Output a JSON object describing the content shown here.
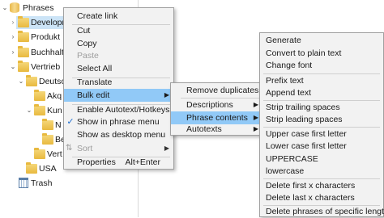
{
  "tree": {
    "items": [
      {
        "label": "Phrases"
      },
      {
        "label": "Developm"
      },
      {
        "label": "Produkt"
      },
      {
        "label": "Buchhaltu"
      },
      {
        "label": "Vertrieb"
      },
      {
        "label": "Deutsc"
      },
      {
        "label": "Akq"
      },
      {
        "label": "Kun"
      },
      {
        "label": "N"
      },
      {
        "label": "Be"
      },
      {
        "label": "Vert"
      },
      {
        "label": "USA"
      },
      {
        "label": "Trash"
      }
    ]
  },
  "context_menu": {
    "items": [
      {
        "label": "Create link"
      },
      {
        "label": "Cut"
      },
      {
        "label": "Copy"
      },
      {
        "label": "Paste"
      },
      {
        "label": "Select All"
      },
      {
        "label": "Translate"
      },
      {
        "label": "Bulk edit"
      },
      {
        "label": "Enable Autotext/Hotkeys"
      },
      {
        "label": "Show in phrase menu"
      },
      {
        "label": "Show as desktop menu"
      },
      {
        "label": "Sort"
      },
      {
        "label": "Properties",
        "shortcut": "Alt+Enter"
      }
    ]
  },
  "bulk_edit_menu": {
    "items": [
      {
        "label": "Remove duplicates"
      },
      {
        "label": "Descriptions"
      },
      {
        "label": "Phrase contents"
      },
      {
        "label": "Autotexts"
      }
    ]
  },
  "phrase_contents_menu": {
    "items": [
      {
        "label": "Generate"
      },
      {
        "label": "Convert to plain text"
      },
      {
        "label": "Change font"
      },
      {
        "label": "Prefix text"
      },
      {
        "label": "Append text"
      },
      {
        "label": "Strip trailing spaces"
      },
      {
        "label": "Strip leading spaces"
      },
      {
        "label": "Upper case first letter"
      },
      {
        "label": "Lower case first letter"
      },
      {
        "label": "UPPERCASE"
      },
      {
        "label": "lowercase"
      },
      {
        "label": "Delete first x characters"
      },
      {
        "label": "Delete last x characters"
      },
      {
        "label": "Delete phrases of specific length"
      }
    ]
  },
  "colors": {
    "highlight": "#91c9f7",
    "selection": "#cce4f7",
    "menu_bg": "#f2f2f2"
  },
  "icons": {
    "check": "✓",
    "submenu": "▶",
    "expanded": "⌄",
    "collapsed": "›"
  }
}
